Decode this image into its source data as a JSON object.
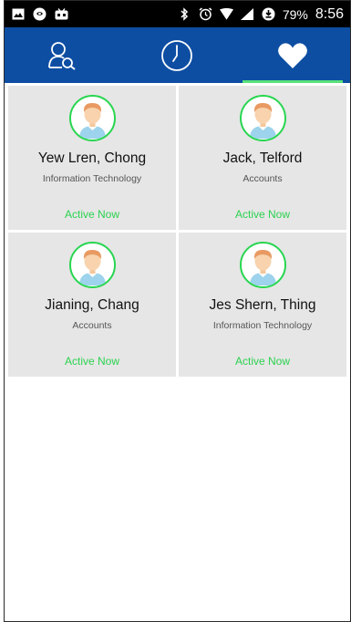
{
  "status_bar": {
    "left_icons": [
      "gallery-icon",
      "app-icon",
      "gamepad-icon"
    ],
    "right_icons": [
      "bluetooth-icon",
      "alarm-icon",
      "wifi-icon",
      "signal-icon",
      "battery-saver-icon"
    ],
    "battery": "79%",
    "time": "8:56"
  },
  "tabs": [
    {
      "icon": "contact-search-icon",
      "active": false
    },
    {
      "icon": "clock-icon",
      "active": false
    },
    {
      "icon": "heart-icon",
      "active": true
    }
  ],
  "colors": {
    "tabbar": "#0d4ea3",
    "active_indicator": "#59e07b",
    "status_text": "#2cd24f",
    "card_bg": "#e6e6e6"
  },
  "contacts": [
    {
      "name": "Yew Lren, Chong",
      "department": "Information Technology",
      "status": "Active Now"
    },
    {
      "name": "Jack, Telford",
      "department": "Accounts",
      "status": "Active Now"
    },
    {
      "name": "Jianing, Chang",
      "department": "Accounts",
      "status": "Active Now"
    },
    {
      "name": "Jes Shern, Thing",
      "department": "Information Technology",
      "status": "Active Now"
    }
  ]
}
